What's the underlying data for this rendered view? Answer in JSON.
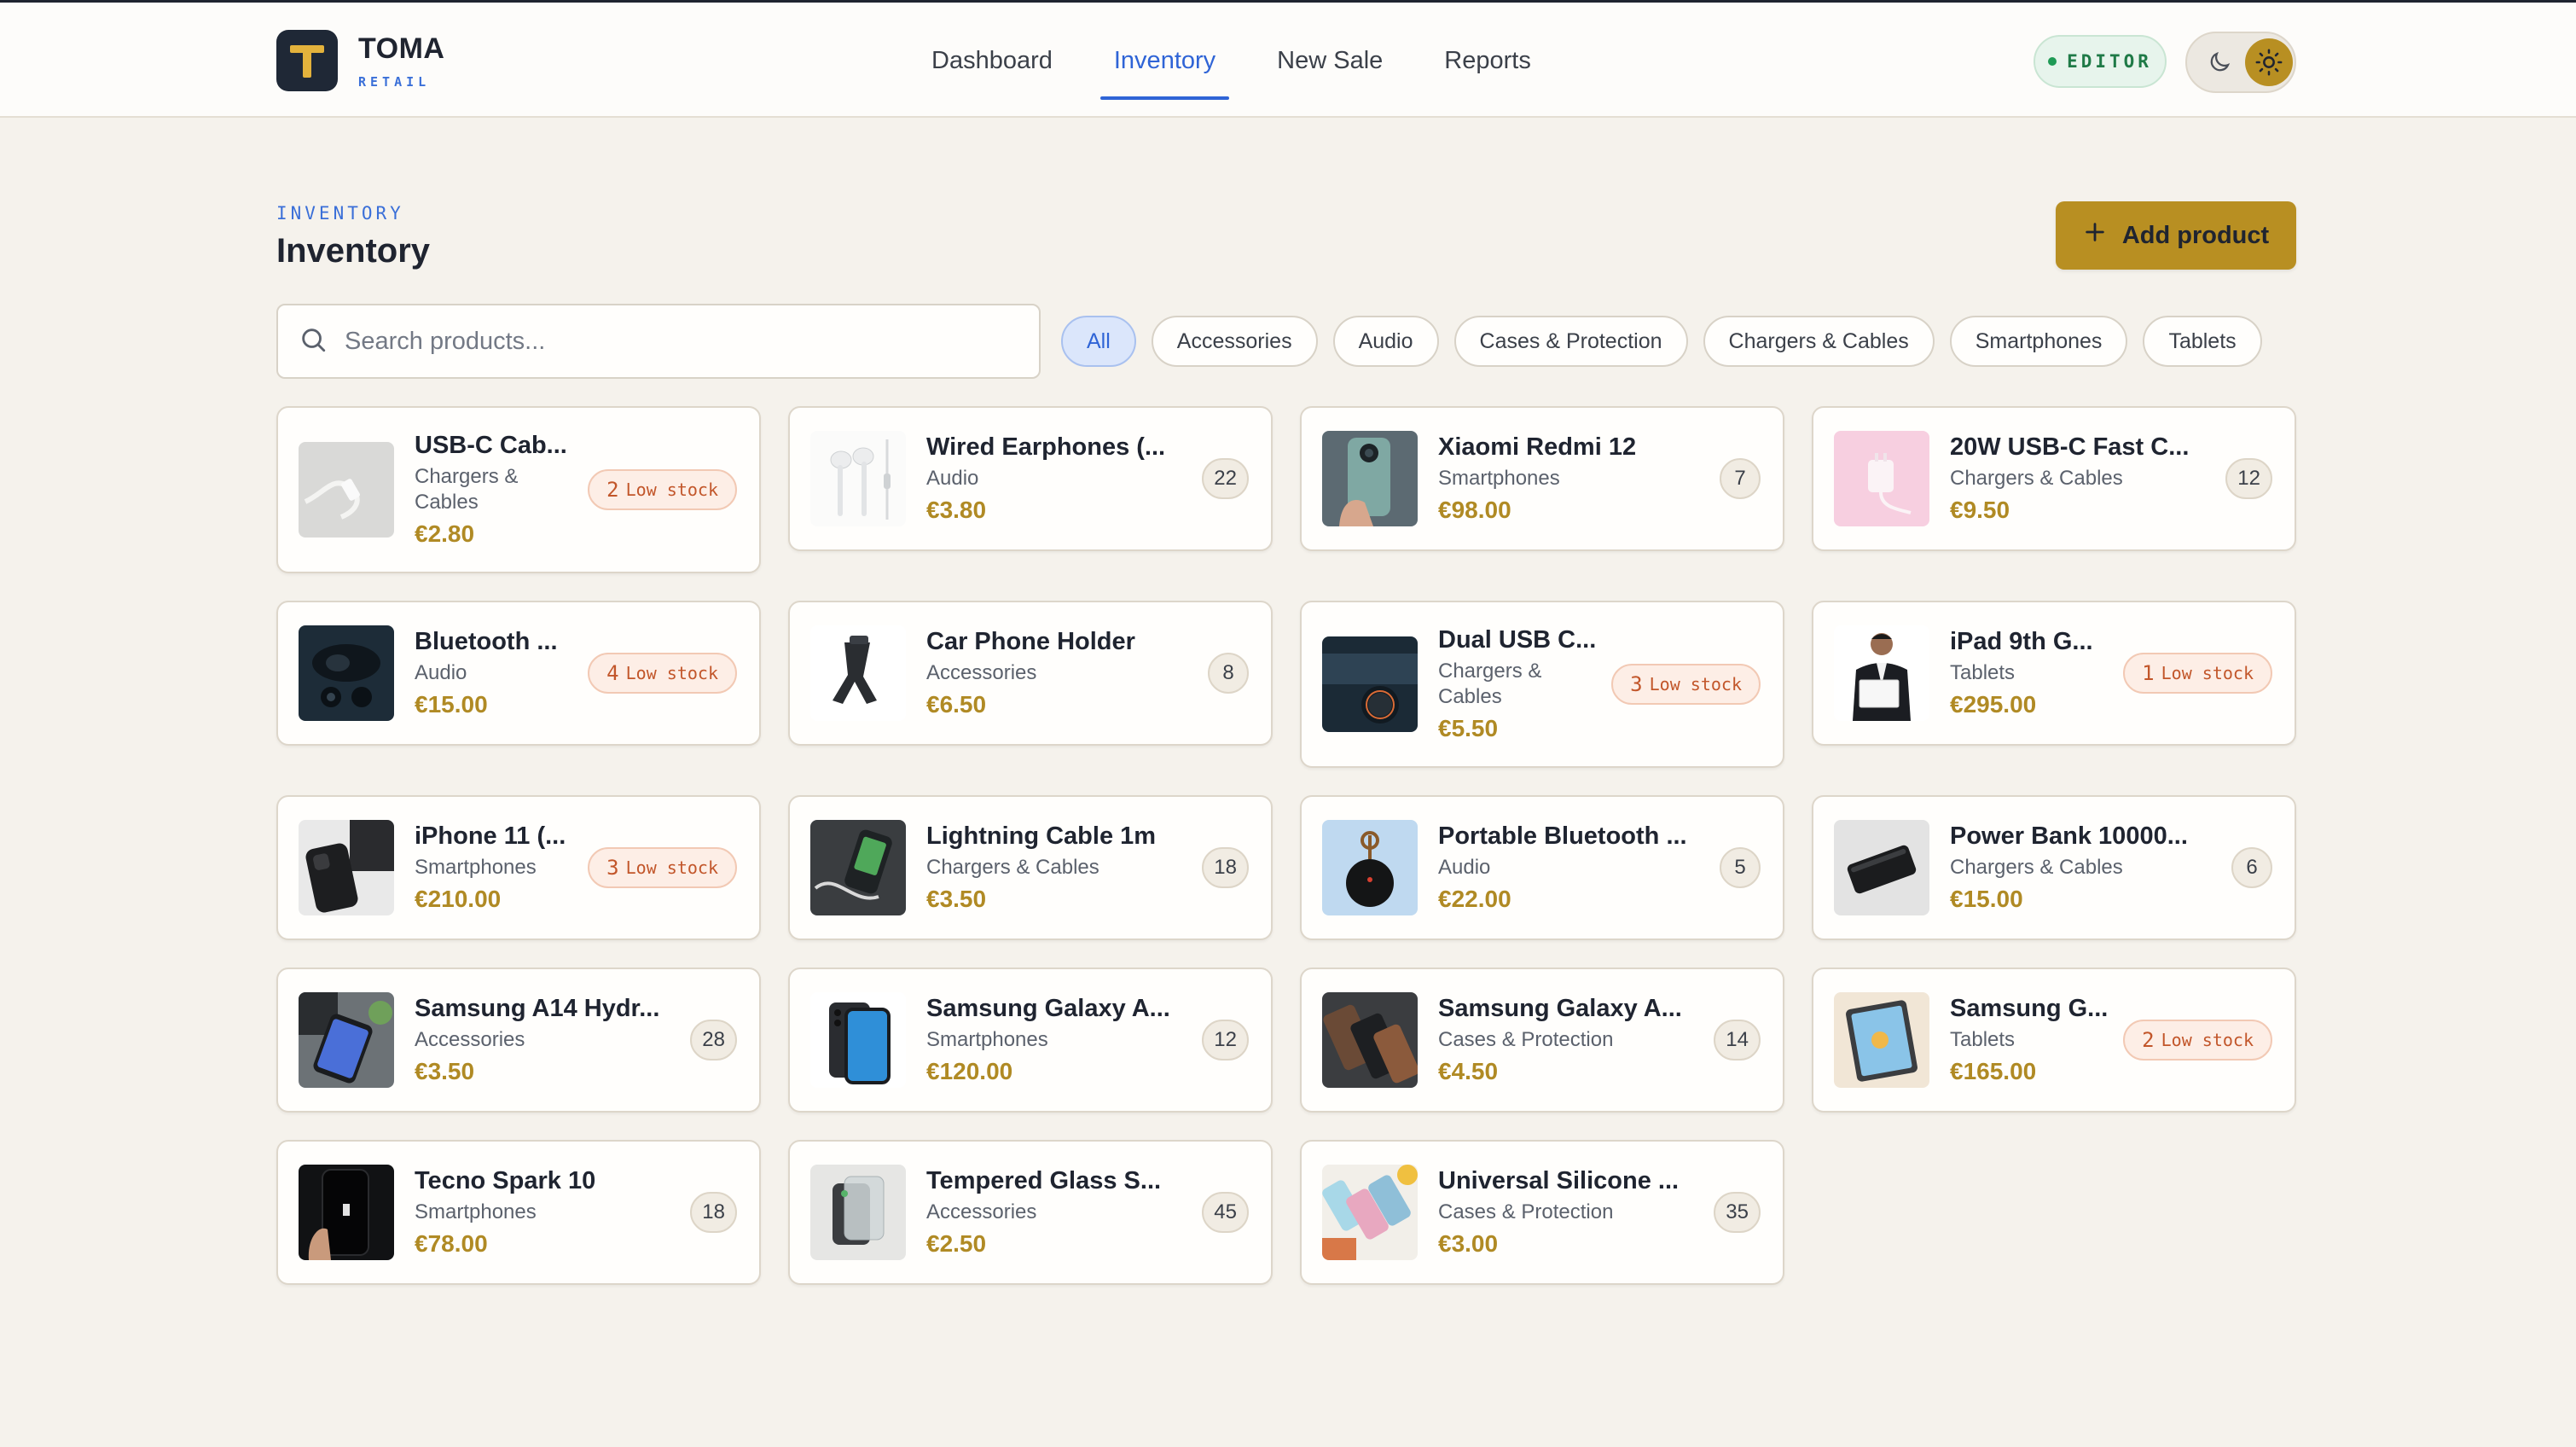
{
  "brand": {
    "name": "TOMA",
    "sub": "RETAIL",
    "logo_letter": "T",
    "colors": {
      "logo_bg": "#1f2836",
      "logo_mark": "#e3b23c"
    }
  },
  "nav": [
    {
      "label": "Dashboard",
      "active": false
    },
    {
      "label": "Inventory",
      "active": true
    },
    {
      "label": "New Sale",
      "active": false
    },
    {
      "label": "Reports",
      "active": false
    }
  ],
  "editor_badge": "EDITOR",
  "theme": {
    "moon_icon": "moon-icon",
    "sun_icon": "sun-icon",
    "selected": "light"
  },
  "page": {
    "eyebrow": "INVENTORY",
    "title": "Inventory",
    "add_button": "Add product"
  },
  "search": {
    "placeholder": "Search products...",
    "value": ""
  },
  "filters": [
    {
      "label": "All",
      "active": true
    },
    {
      "label": "Accessories",
      "active": false
    },
    {
      "label": "Audio",
      "active": false
    },
    {
      "label": "Cases & Protection",
      "active": false
    },
    {
      "label": "Chargers & Cables",
      "active": false
    },
    {
      "label": "Smartphones",
      "active": false
    },
    {
      "label": "Tablets",
      "active": false
    }
  ],
  "low_stock_label": "Low stock",
  "colors": {
    "accent": "#b88f22",
    "price": "#b08a24",
    "link": "#2f64d6",
    "low_stock": "#c2562a",
    "editor": "#1f7a47"
  },
  "products": [
    {
      "name": "USB-C Cab...",
      "category": "Chargers & Cables",
      "price": "€2.80",
      "stock": "2",
      "low": true,
      "thumb": "usb-cable"
    },
    {
      "name": "Wired Earphones (...",
      "category": "Audio",
      "price": "€3.80",
      "stock": "22",
      "low": false,
      "thumb": "earphones"
    },
    {
      "name": "Xiaomi Redmi 12",
      "category": "Smartphones",
      "price": "€98.00",
      "stock": "7",
      "low": false,
      "thumb": "phone-hand"
    },
    {
      "name": "20W USB-C Fast C...",
      "category": "Chargers & Cables",
      "price": "€9.50",
      "stock": "12",
      "low": false,
      "thumb": "charger-pink"
    },
    {
      "name": "Bluetooth ...",
      "category": "Audio",
      "price": "€15.00",
      "stock": "4",
      "low": true,
      "thumb": "earbuds-case"
    },
    {
      "name": "Car Phone Holder",
      "category": "Accessories",
      "price": "€6.50",
      "stock": "8",
      "low": false,
      "thumb": "car-holder"
    },
    {
      "name": "Dual USB C...",
      "category": "Chargers & Cables",
      "price": "€5.50",
      "stock": "3",
      "low": true,
      "thumb": "car-charger"
    },
    {
      "name": "iPad 9th G...",
      "category": "Tablets",
      "price": "€295.00",
      "stock": "1",
      "low": true,
      "thumb": "person-tablet"
    },
    {
      "name": "iPhone 11 (...",
      "category": "Smartphones",
      "price": "€210.00",
      "stock": "3",
      "low": true,
      "thumb": "iphone-dark"
    },
    {
      "name": "Lightning Cable 1m",
      "category": "Chargers & Cables",
      "price": "€3.50",
      "stock": "18",
      "low": false,
      "thumb": "cable-phone"
    },
    {
      "name": "Portable Bluetooth ...",
      "category": "Audio",
      "price": "€22.00",
      "stock": "5",
      "low": false,
      "thumb": "speaker"
    },
    {
      "name": "Power Bank 10000...",
      "category": "Chargers & Cables",
      "price": "€15.00",
      "stock": "6",
      "low": false,
      "thumb": "power-bank"
    },
    {
      "name": "Samsung A14 Hydr...",
      "category": "Accessories",
      "price": "€3.50",
      "stock": "28",
      "low": false,
      "thumb": "phone-desk"
    },
    {
      "name": "Samsung Galaxy A...",
      "category": "Smartphones",
      "price": "€120.00",
      "stock": "12",
      "low": false,
      "thumb": "galaxy-back"
    },
    {
      "name": "Samsung Galaxy A...",
      "category": "Cases & Protection",
      "price": "€4.50",
      "stock": "14",
      "low": false,
      "thumb": "leather-cases"
    },
    {
      "name": "Samsung G...",
      "category": "Tablets",
      "price": "€165.00",
      "stock": "2",
      "low": true,
      "thumb": "tablet-art"
    },
    {
      "name": "Tecno Spark 10",
      "category": "Smartphones",
      "price": "€78.00",
      "stock": "18",
      "low": false,
      "thumb": "phone-black"
    },
    {
      "name": "Tempered Glass S...",
      "category": "Accessories",
      "price": "€2.50",
      "stock": "45",
      "low": false,
      "thumb": "glass-protector"
    },
    {
      "name": "Universal Silicone ...",
      "category": "Cases & Protection",
      "price": "€3.00",
      "stock": "35",
      "low": false,
      "thumb": "silicone-cases"
    }
  ]
}
